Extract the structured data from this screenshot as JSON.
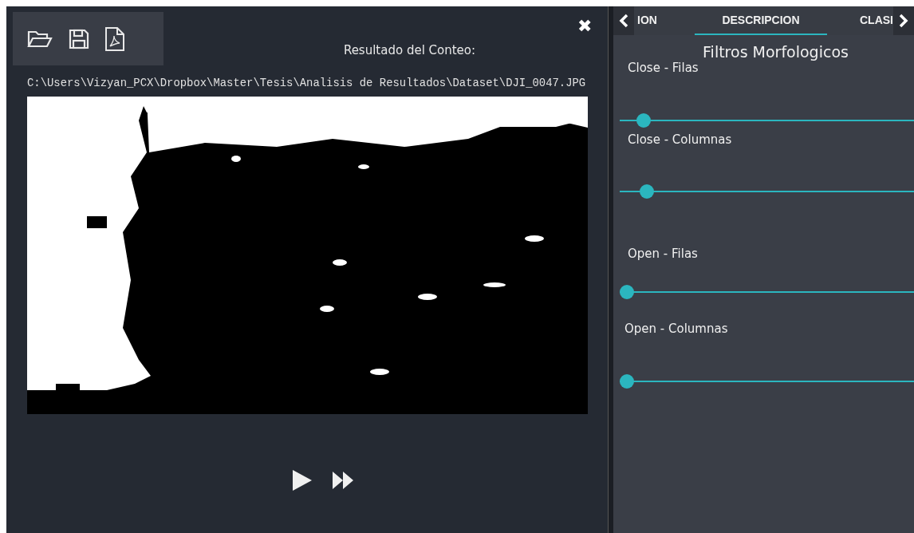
{
  "toolbar": {
    "buttons": [
      {
        "kind": "open"
      },
      {
        "kind": "save"
      },
      {
        "kind": "pdf"
      }
    ]
  },
  "close_symbol": "✖",
  "result_title": "Resultado del Conteo:",
  "file_path": "C:\\Users\\Vizyan_PCX\\Dropbox\\Master\\Tesis\\Analisis de Resultados\\Dataset\\DJI_0047.JPG",
  "playback": [
    {
      "kind": "play"
    },
    {
      "kind": "fast-forward"
    }
  ],
  "tabs": [
    {
      "label": "ION",
      "selected": false
    },
    {
      "label": "DESCRIPCION",
      "selected": true
    },
    {
      "label": "CLASI",
      "selected": false
    }
  ],
  "section_title": "Filtros Morfologicos",
  "sliders": [
    {
      "label": "Close - Filas",
      "level": 0.06
    },
    {
      "label": "Close - Columnas",
      "level": 0.07
    },
    {
      "label": "Open - Filas",
      "level": 0
    },
    {
      "label": "Open - Columnas",
      "level": 0
    }
  ]
}
